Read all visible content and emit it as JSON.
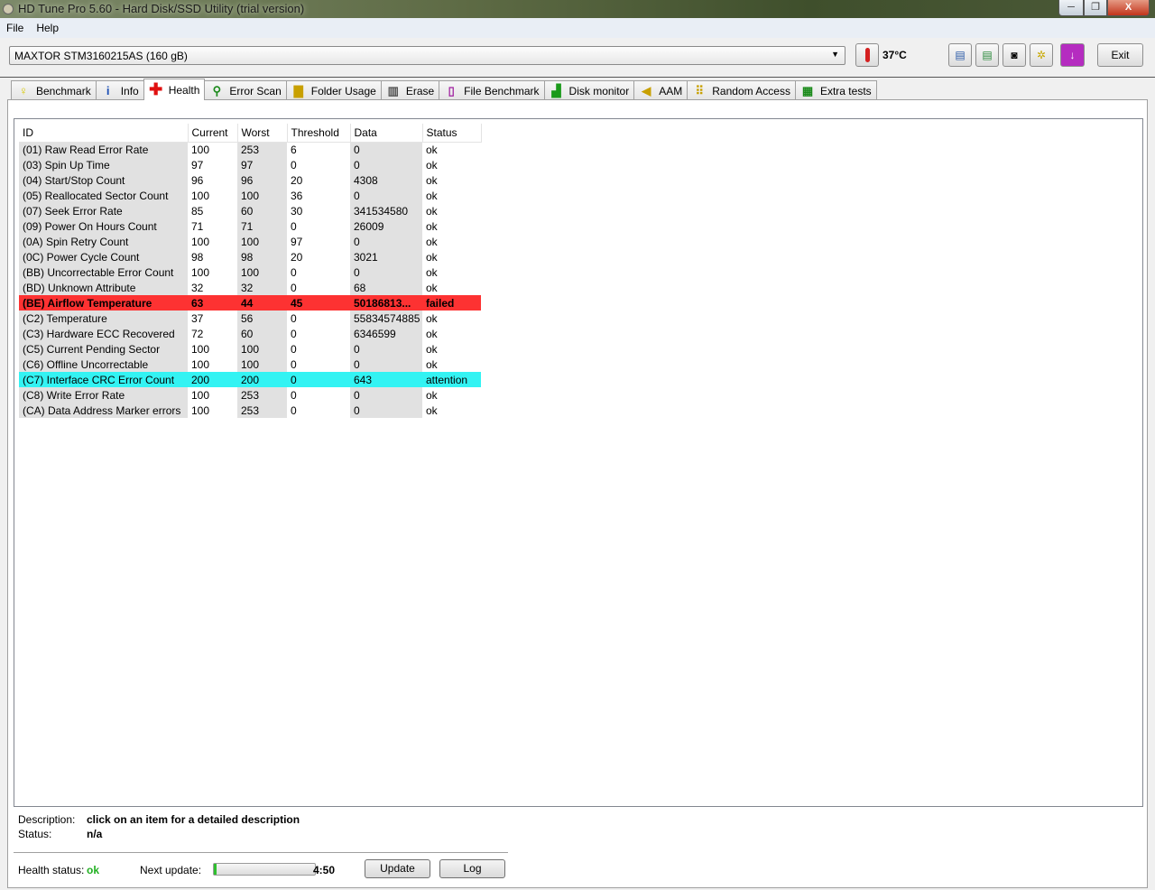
{
  "window": {
    "title": "HD Tune Pro 5.60 - Hard Disk/SSD Utility (trial version)",
    "minimize": "─",
    "maximize": "❐",
    "close": "X"
  },
  "menu": [
    {
      "label": "File"
    },
    {
      "label": "Help"
    }
  ],
  "toolbar": {
    "drive": "MAXTOR STM3160215AS (160 gB)",
    "temperature": "37°C",
    "exit_label": "Exit"
  },
  "tabs": [
    {
      "label": "Benchmark",
      "icon": "lightbulb-icon"
    },
    {
      "label": "Info",
      "icon": "info-icon"
    },
    {
      "label": "Health",
      "icon": "red-cross-icon"
    },
    {
      "label": "Error Scan",
      "icon": "magnifier-icon"
    },
    {
      "label": "Folder Usage",
      "icon": "folder-icon"
    },
    {
      "label": "Erase",
      "icon": "trash-icon"
    },
    {
      "label": "File Benchmark",
      "icon": "file-icon"
    },
    {
      "label": "Disk monitor",
      "icon": "chart-icon"
    },
    {
      "label": "AAM",
      "icon": "speaker-icon"
    },
    {
      "label": "Random Access",
      "icon": "scatter-icon"
    },
    {
      "label": "Extra tests",
      "icon": "calculator-icon"
    }
  ],
  "table": {
    "columns": [
      "ID",
      "Current",
      "Worst",
      "Threshold",
      "Data",
      "Status"
    ],
    "rows": [
      [
        "(01) Raw Read Error Rate",
        "100",
        "253",
        "6",
        "0",
        "ok"
      ],
      [
        "(03) Spin Up Time",
        "97",
        "97",
        "0",
        "0",
        "ok"
      ],
      [
        "(04) Start/Stop Count",
        "96",
        "96",
        "20",
        "4308",
        "ok"
      ],
      [
        "(05) Reallocated Sector Count",
        "100",
        "100",
        "36",
        "0",
        "ok"
      ],
      [
        "(07) Seek Error Rate",
        "85",
        "60",
        "30",
        "341534580",
        "ok"
      ],
      [
        "(09) Power On Hours Count",
        "71",
        "71",
        "0",
        "26009",
        "ok"
      ],
      [
        "(0A) Spin Retry Count",
        "100",
        "100",
        "97",
        "0",
        "ok"
      ],
      [
        "(0C) Power Cycle Count",
        "98",
        "98",
        "20",
        "3021",
        "ok"
      ],
      [
        "(BB) Uncorrectable Error Count",
        "100",
        "100",
        "0",
        "0",
        "ok"
      ],
      [
        "(BD) Unknown Attribute",
        "32",
        "32",
        "0",
        "68",
        "ok"
      ],
      [
        "(BE) Airflow Temperature",
        "63",
        "44",
        "45",
        "50186813...",
        "failed"
      ],
      [
        "(C2) Temperature",
        "37",
        "56",
        "0",
        "55834574885",
        "ok"
      ],
      [
        "(C3) Hardware ECC Recovered",
        "72",
        "60",
        "0",
        "6346599",
        "ok"
      ],
      [
        "(C5) Current Pending Sector",
        "100",
        "100",
        "0",
        "0",
        "ok"
      ],
      [
        "(C6) Offline Uncorrectable",
        "100",
        "100",
        "0",
        "0",
        "ok"
      ],
      [
        "(C7) Interface CRC Error Count",
        "200",
        "200",
        "0",
        "643",
        "attention"
      ],
      [
        "(C8) Write Error Rate",
        "100",
        "253",
        "0",
        "0",
        "ok"
      ],
      [
        "(CA) Data Address Marker errors",
        "100",
        "253",
        "0",
        "0",
        "ok"
      ]
    ]
  },
  "details": {
    "description_label": "Description:",
    "description": "click on an item for a detailed description",
    "status_label": "Status:",
    "status": "n/a"
  },
  "footer": {
    "health_label": "Health status:",
    "health": "ok",
    "next_update_label": "Next update:",
    "next_update_progress_percent": 3,
    "countdown": "4:50",
    "update_label": "Update",
    "log_label": "Log"
  },
  "colors": {
    "failed": "#fd3232",
    "attention": "#33f3f3",
    "ok": "#22b022"
  }
}
